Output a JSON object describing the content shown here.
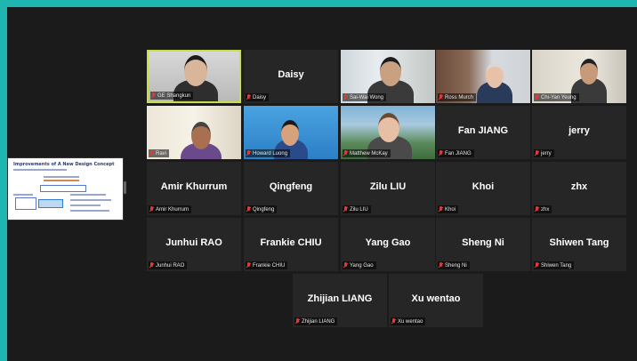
{
  "shared_screen": {
    "title": "Improvements of A New Design Concept"
  },
  "participants": [
    {
      "name": "GE Shangkun",
      "display": "",
      "video": true,
      "active": true
    },
    {
      "name": "Daisy",
      "display": "Daisy",
      "video": false
    },
    {
      "name": "Sai-Wai Wong",
      "display": "",
      "video": true
    },
    {
      "name": "Ross Murch",
      "display": "",
      "video": true
    },
    {
      "name": "Chi-Yan Yeung",
      "display": "",
      "video": true
    },
    {
      "name": "Ravi",
      "display": "",
      "video": true
    },
    {
      "name": "Howard Luong",
      "display": "",
      "video": true
    },
    {
      "name": "Matthew McKay",
      "display": "",
      "video": true
    },
    {
      "name": "Fan JIANG",
      "display": "Fan JIANG",
      "video": false
    },
    {
      "name": "jerry",
      "display": "jerry",
      "video": false
    },
    {
      "name": "Amir Khurrum",
      "display": "Amir Khurrum",
      "video": false
    },
    {
      "name": "Qingfeng",
      "display": "Qingfeng",
      "video": false
    },
    {
      "name": "Zilu LIU",
      "display": "Zilu LIU",
      "video": false
    },
    {
      "name": "Khoi",
      "display": "Khoi",
      "video": false
    },
    {
      "name": "zhx",
      "display": "zhx",
      "video": false
    },
    {
      "name": "Junhui RAO",
      "display": "Junhui RAO",
      "video": false
    },
    {
      "name": "Frankie CHIU",
      "display": "Frankie CHIU",
      "video": false
    },
    {
      "name": "Yang Gao",
      "display": "Yang Gao",
      "video": false
    },
    {
      "name": "Sheng Ni",
      "display": "Sheng Ni",
      "video": false
    },
    {
      "name": "Shiwen Tang",
      "display": "Shiwen Tang",
      "video": false
    },
    {
      "name": "Zhijian LIANG",
      "display": "Zhijian LIANG",
      "video": false
    },
    {
      "name": "Xu wentao",
      "display": "Xu wentao",
      "video": false
    }
  ],
  "colors": {
    "accent_border": "#c7e04a",
    "mute_icon": "#e03a3a",
    "tile_bg": "#262626",
    "page_bg": "#1b1b1b"
  }
}
